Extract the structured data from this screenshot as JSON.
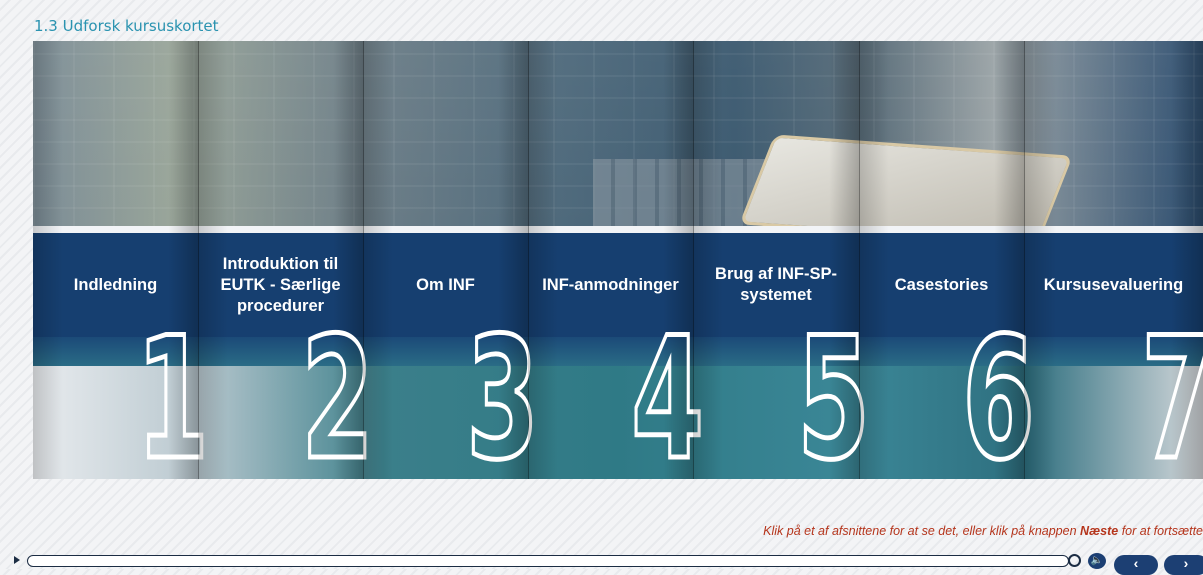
{
  "page": {
    "title": "1.3 Udforsk kursuskortet"
  },
  "sections": [
    {
      "label": "Indledning",
      "number": "1"
    },
    {
      "label": "Introduktion til EUTK - Særlige procedurer",
      "number": "2"
    },
    {
      "label": "Om INF",
      "number": "3"
    },
    {
      "label": "INF-anmodninger",
      "number": "4"
    },
    {
      "label": "Brug af INF-SP-systemet",
      "number": "5"
    },
    {
      "label": "Casestories",
      "number": "6"
    },
    {
      "label": "Kursusevaluering",
      "number": "7"
    }
  ],
  "hint": {
    "before": "Klik på et af afsnittene for at se det, eller klik på knappen ",
    "emphasis": "Næste",
    "after": " for at fortsætte"
  },
  "controls": {
    "play_icon": "play-icon",
    "search_icon": "search-icon",
    "sound_icon": "speaker-icon",
    "prev_label": "‹",
    "next_label": "›"
  },
  "colors": {
    "band": "#163f70",
    "title": "#2a93b0",
    "hint": "#b5351c",
    "button": "#1c3f73"
  }
}
